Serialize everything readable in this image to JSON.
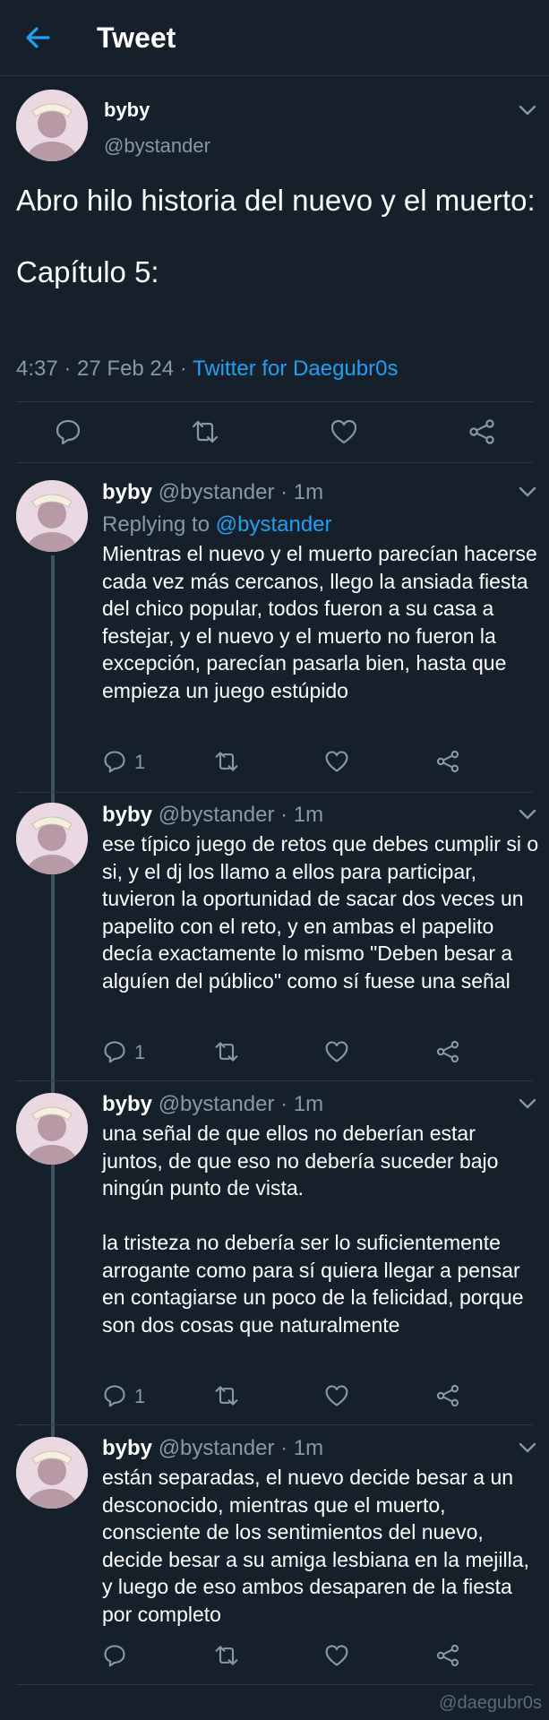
{
  "header": {
    "title": "Tweet"
  },
  "main_tweet": {
    "name": "byby",
    "handle": "@bystander",
    "text": "Abro hilo historia del nuevo y el muerto:\n\nCapítulo 5:",
    "time": "4:37 · 27 Feb 24 · ",
    "source": "Twitter for Daegubr0s"
  },
  "replies": [
    {
      "name": "byby",
      "meta": "@bystander · 1m",
      "replying_prefix": "Replying to ",
      "replying_handle": "@bystander",
      "text": "Mientras el nuevo y el muerto parecían hacerse cada vez más cercanos, llego la ansiada fiesta del chico popular, todos fueron a su casa a festejar, y el nuevo y el muerto no fueron la excepción, parecían pasarla bien, hasta que empieza un juego estúpido",
      "reply_count": "1"
    },
    {
      "name": "byby",
      "meta": "@bystander · 1m",
      "text": "ese típico juego de retos que debes cumplir si o si, y el dj los llamo a ellos para participar, tuvieron la oportunidad de sacar dos veces un papelito con el reto, y en ambas el papelito decía exactamente lo mismo \"Deben besar a alguíen del público\" como sí fuese una señal",
      "reply_count": "1"
    },
    {
      "name": "byby",
      "meta": "@bystander · 1m",
      "text": "una señal de que ellos no deberían estar juntos, de que eso no debería suceder bajo ningún punto de vista.\n\nla tristeza no debería ser lo suficientemente arrogante como para sí quiera llegar a pensar en contagiarse un poco de la felicidad, porque son dos cosas que naturalmente",
      "reply_count": "1"
    },
    {
      "name": "byby",
      "meta": "@bystander · 1m",
      "text": "están separadas, el nuevo decide besar a un desconocido, mientras que el muerto, consciente de los sentimientos del nuevo, decide besar a su amiga lesbiana en la mejilla, y luego de eso ambos desaparen de la fiesta por completo",
      "reply_count": ""
    }
  ],
  "watermark": "@daegubr0s",
  "icons": {
    "back": "arrow-left-icon",
    "reply": "speech-bubble-icon",
    "retweet": "retweet-icon",
    "like": "heart-icon",
    "share": "share-icon",
    "more": "chevron-down-icon"
  },
  "colors": {
    "background": "#15202b",
    "accent": "#1da1f2",
    "muted": "#8899a6"
  }
}
